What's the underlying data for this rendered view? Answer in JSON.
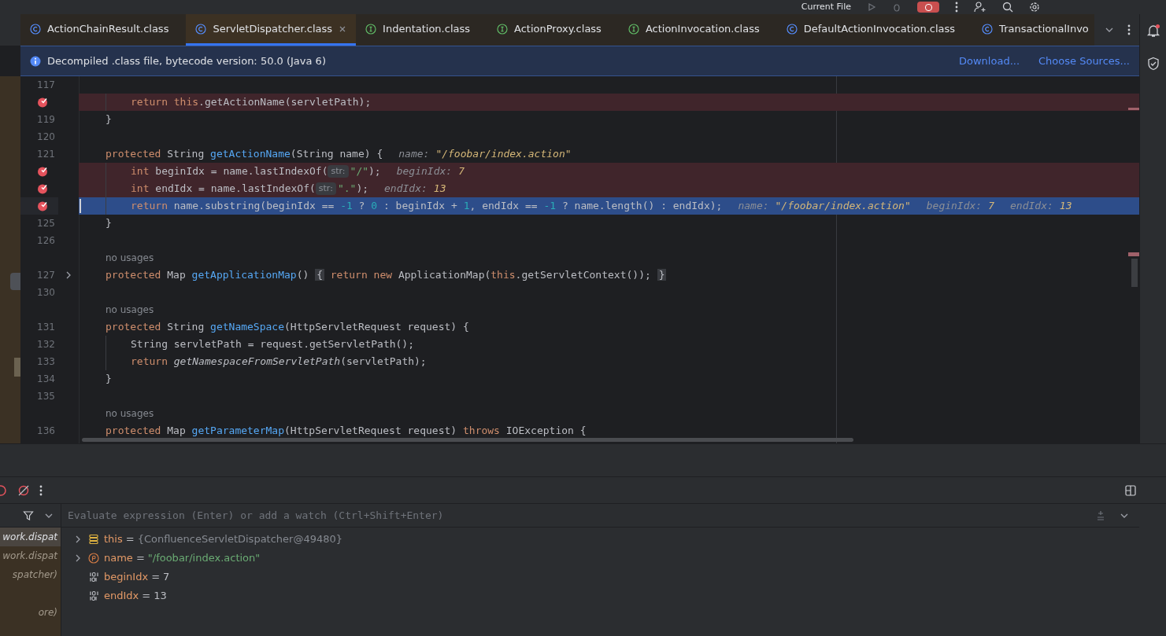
{
  "toolbar": {
    "run_config": "Current File"
  },
  "tabs": [
    {
      "label": "ActionChainResult.class",
      "kind": "class",
      "selected": false
    },
    {
      "label": "ServletDispatcher.class",
      "kind": "class",
      "selected": true
    },
    {
      "label": "Indentation.class",
      "kind": "interface",
      "selected": false
    },
    {
      "label": "ActionProxy.class",
      "kind": "interface",
      "selected": false
    },
    {
      "label": "ActionInvocation.class",
      "kind": "interface",
      "selected": false
    },
    {
      "label": "DefaultActionInvocation.class",
      "kind": "class",
      "selected": false
    },
    {
      "label": "TransactionalInvo",
      "kind": "class",
      "selected": false
    }
  ],
  "banner": {
    "message": "Decompiled .class file, bytecode version: 50.0 (Java 6)",
    "links": [
      "Download...",
      "Choose Sources..."
    ]
  },
  "code_lines": [
    {
      "kind": "normal",
      "number": "117"
    },
    {
      "kind": "breakpoint",
      "indented": true,
      "tokens": [
        {
          "kind": "kw",
          "text": "return this"
        },
        {
          "kind": "p",
          "text": ".getActionName(servletPath);"
        }
      ]
    },
    {
      "kind": "normal",
      "number": "119",
      "tokens": [
        {
          "kind": "p",
          "text": "}"
        }
      ]
    },
    {
      "kind": "normal",
      "number": "120"
    },
    {
      "kind": "normal",
      "number": "121",
      "tokens": [
        {
          "kind": "kw",
          "text": "protected "
        },
        {
          "kind": "p",
          "text": "String "
        },
        {
          "kind": "fn",
          "text": "getActionName"
        },
        {
          "kind": "p",
          "text": "(String name) {"
        },
        {
          "kind": "ivn",
          "text": "name:"
        },
        {
          "kind": "ivv",
          "text": "\"/foobar/index.action\""
        }
      ]
    },
    {
      "kind": "breakpoint",
      "indented": true,
      "tokens": [
        {
          "kind": "kw",
          "text": "int "
        },
        {
          "kind": "p",
          "text": "beginIdx = name.lastIndexOf("
        },
        {
          "kind": "chip",
          "text": "str:"
        },
        {
          "kind": "str",
          "text": "\"/\""
        },
        {
          "kind": "p",
          "text": ");"
        },
        {
          "kind": "ivn",
          "text": "beginIdx:"
        },
        {
          "kind": "ivv",
          "text": "7"
        }
      ]
    },
    {
      "kind": "breakpoint",
      "indented": true,
      "tokens": [
        {
          "kind": "kw",
          "text": "int "
        },
        {
          "kind": "p",
          "text": "endIdx = name.lastIndexOf("
        },
        {
          "kind": "chip",
          "text": "str:"
        },
        {
          "kind": "str",
          "text": "\".\""
        },
        {
          "kind": "p",
          "text": ");"
        },
        {
          "kind": "ivn",
          "text": "endIdx:"
        },
        {
          "kind": "ivv",
          "text": "13"
        }
      ]
    },
    {
      "kind": "current",
      "indented": true,
      "tokens": [
        {
          "kind": "kw",
          "text": "return "
        },
        {
          "kind": "p",
          "text": "name.substring(beginIdx == "
        },
        {
          "kind": "num",
          "text": "-1"
        },
        {
          "kind": "p",
          "text": " ? "
        },
        {
          "kind": "num",
          "text": "0"
        },
        {
          "kind": "p",
          "text": " : beginIdx + "
        },
        {
          "kind": "num",
          "text": "1"
        },
        {
          "kind": "p",
          "text": ", endIdx == "
        },
        {
          "kind": "num",
          "text": "-1"
        },
        {
          "kind": "p",
          "text": " ? name.length() : endIdx);"
        },
        {
          "kind": "ivn",
          "text": "name:"
        },
        {
          "kind": "ivv",
          "text": "\"/foobar/index.action\""
        },
        {
          "kind": "ivn",
          "text": "beginIdx:"
        },
        {
          "kind": "ivv",
          "text": "7"
        },
        {
          "kind": "ivn",
          "text": "endIdx:"
        },
        {
          "kind": "ivv",
          "text": "13"
        }
      ]
    },
    {
      "kind": "normal",
      "number": "125",
      "tokens": [
        {
          "kind": "p",
          "text": "}"
        }
      ]
    },
    {
      "kind": "normal",
      "number": "126"
    },
    {
      "kind": "usages",
      "text": "no usages"
    },
    {
      "kind": "normal",
      "number": "127",
      "folded": true,
      "tokens": [
        {
          "kind": "kw",
          "text": "protected "
        },
        {
          "kind": "p",
          "text": "Map "
        },
        {
          "kind": "fn",
          "text": "getApplicationMap"
        },
        {
          "kind": "p",
          "text": "() "
        },
        {
          "kind": "fold",
          "text": "{"
        },
        {
          "kind": "kw",
          "text": " return new "
        },
        {
          "kind": "p",
          "text": "ApplicationMap("
        },
        {
          "kind": "kw",
          "text": "this"
        },
        {
          "kind": "p",
          "text": ".getServletContext()); "
        },
        {
          "kind": "fold",
          "text": "}"
        }
      ]
    },
    {
      "kind": "normal",
      "number": "130"
    },
    {
      "kind": "usages",
      "text": "no usages"
    },
    {
      "kind": "normal",
      "number": "131",
      "tokens": [
        {
          "kind": "kw",
          "text": "protected "
        },
        {
          "kind": "p",
          "text": "String "
        },
        {
          "kind": "fn",
          "text": "getNameSpace"
        },
        {
          "kind": "p",
          "text": "(HttpServletRequest request) {"
        }
      ]
    },
    {
      "kind": "normal",
      "number": "132",
      "indented": true,
      "tokens": [
        {
          "kind": "p",
          "text": "String servletPath = request.getServletPath();"
        }
      ]
    },
    {
      "kind": "normal",
      "number": "133",
      "indented": true,
      "tokens": [
        {
          "kind": "kw",
          "text": "return "
        },
        {
          "kind": "it",
          "text": "getNamespaceFromServletPath"
        },
        {
          "kind": "p",
          "text": "(servletPath);"
        }
      ]
    },
    {
      "kind": "normal",
      "number": "134",
      "tokens": [
        {
          "kind": "p",
          "text": "}"
        }
      ]
    },
    {
      "kind": "normal",
      "number": "135"
    },
    {
      "kind": "usages",
      "text": "no usages"
    },
    {
      "kind": "normal",
      "number": "136",
      "tokens": [
        {
          "kind": "kw",
          "text": "protected "
        },
        {
          "kind": "p",
          "text": "Map "
        },
        {
          "kind": "fn",
          "text": "getParameterMap"
        },
        {
          "kind": "p",
          "text": "(HttpServletRequest request) "
        },
        {
          "kind": "kw",
          "text": "throws "
        },
        {
          "kind": "p",
          "text": "IOException {"
        }
      ]
    }
  ],
  "frames": [
    {
      "label": "work.dispat",
      "selected": true
    },
    {
      "label": "work.dispat",
      "selected": false
    },
    {
      "label": "spatcher)",
      "selected": false
    },
    {
      "label": "ore)",
      "selected": false
    }
  ],
  "evaluate": {
    "placeholder": "Evaluate expression (Enter) or add a watch (Ctrl+Shift+Enter)"
  },
  "variables": [
    {
      "kind": "object",
      "expandable": true,
      "name": "this",
      "operator": "=",
      "value": "{ConfluenceServletDispatcher@49480}"
    },
    {
      "kind": "param",
      "expandable": true,
      "name": "name",
      "operator": "=",
      "value": "\"/foobar/index.action\""
    },
    {
      "kind": "primitive",
      "expandable": false,
      "name": "beginIdx",
      "operator": "=",
      "value": "7"
    },
    {
      "kind": "primitive",
      "expandable": false,
      "name": "endIdx",
      "operator": "=",
      "value": "13"
    }
  ]
}
